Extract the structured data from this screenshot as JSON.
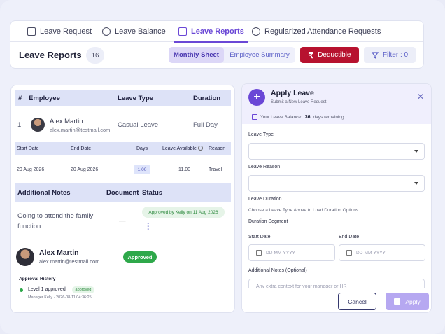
{
  "tabs": [
    {
      "label": "Leave Request",
      "icon": "clipboard-icon"
    },
    {
      "label": "Leave Balance",
      "icon": "pie-chart-icon"
    },
    {
      "label": "Leave Reports",
      "icon": "clipboard-check-icon",
      "active": true
    },
    {
      "label": "Regularized Attendance Requests",
      "icon": "clock-icon"
    }
  ],
  "header": {
    "title": "Leave Reports",
    "count": "16",
    "view_toggle": {
      "selected": "Monthly Sheet",
      "other": "Employee Summary"
    },
    "deductible_label": "Deductible",
    "deductible_icon": "₹",
    "filter_label": "Filter : 0"
  },
  "colors": {
    "accent": "#6a47d6",
    "danger": "#b7122f",
    "success": "#2ea84a"
  },
  "report": {
    "cols1": {
      "num": "#",
      "employee": "Employee",
      "leave_type": "Leave Type",
      "duration": "Duration"
    },
    "row": {
      "num": "1",
      "name": "Alex Martin",
      "email": "alex.martin@testmail.com",
      "leave_type": "Casual Leave",
      "duration": "Full Day"
    },
    "cols2": {
      "start": "Start Date",
      "end": "End Date",
      "days": "Days",
      "available": "Leave Available",
      "reason": "Reason"
    },
    "row2": {
      "start": "20 Aug 2026",
      "end": "20 Aug 2026",
      "days": "1.00",
      "available": "11.00",
      "reason": "Travel"
    },
    "cols3": {
      "notes": "Additional Notes",
      "document": "Document",
      "status": "Status"
    },
    "row3": {
      "notes_line1": "Going to attend the family",
      "notes_line2": "function.",
      "document": "—",
      "status_text": "Approved by Kelly on 11 Aug 2026"
    },
    "profile": {
      "name": "Alex Martin",
      "email": "alex.martin@testmail.com",
      "status": "Approved",
      "history_title": "Approval History",
      "level": "Level 1 approved",
      "level_status": "approved",
      "approver_meta": "Manager Kelly · 2026-08-11 04:36:25"
    }
  },
  "apply_panel": {
    "title": "Apply Leave",
    "subtitle": "Submit a New Leave Request",
    "balance_label": "Your Leave Balance:",
    "balance_value": "36",
    "balance_suffix": "days remaining",
    "leave_type_label": "Leave Type",
    "leave_reason_label": "Leave Reason",
    "leave_duration_label": "Leave Duration",
    "duration_hint": "Choose a Leave Type Above to Load Duration Options.",
    "duration_segment_label": "Duration Segment",
    "start_date_label": "Start Date",
    "end_date_label": "End Date",
    "date_placeholder": "DD-MM-YYYY",
    "notes_label": "Additional Notes (Optional)",
    "notes_placeholder": "Any extra context for your manager or HR",
    "cancel_label": "Cancel",
    "apply_label": "Apply"
  }
}
